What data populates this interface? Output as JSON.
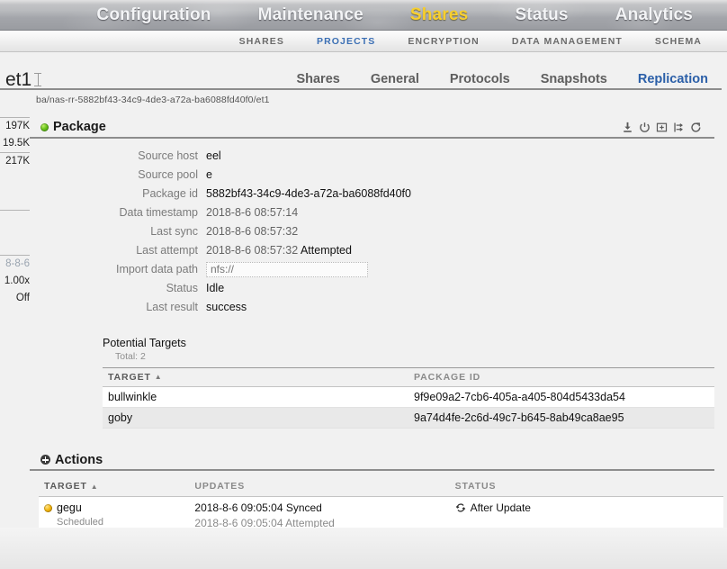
{
  "topnav": {
    "items": [
      {
        "label": "Configuration",
        "active": false
      },
      {
        "label": "Maintenance",
        "active": false
      },
      {
        "label": "Shares",
        "active": true
      },
      {
        "label": "Status",
        "active": false
      },
      {
        "label": "Analytics",
        "active": false
      }
    ],
    "active_color": "#f7cf2e"
  },
  "subnav": {
    "items": [
      {
        "label": "SHARES",
        "active": false
      },
      {
        "label": "PROJECTS",
        "active": true
      },
      {
        "label": "ENCRYPTION",
        "active": false
      },
      {
        "label": "DATA MANAGEMENT",
        "active": false
      },
      {
        "label": "SCHEMA",
        "active": false
      }
    ],
    "active_color": "#3b6fb4"
  },
  "page": {
    "title": "et1",
    "breadcrumb": "ba/nas-rr-5882bf43-34c9-4de3-a72a-ba6088fd40f0/et1",
    "tabs": [
      {
        "label": "Shares",
        "active": false
      },
      {
        "label": "General",
        "active": false
      },
      {
        "label": "Protocols",
        "active": false
      },
      {
        "label": "Snapshots",
        "active": false
      },
      {
        "label": "Replication",
        "active": true
      }
    ]
  },
  "sidebar": {
    "values": [
      {
        "text": "197K",
        "muted": false
      },
      {
        "text": "19.5K",
        "muted": false
      },
      {
        "text": "217K",
        "muted": false
      },
      {
        "text": "8-8-6",
        "muted": true
      },
      {
        "text": "1.00x",
        "muted": false
      },
      {
        "text": "Off",
        "muted": false
      }
    ]
  },
  "package": {
    "title": "Package",
    "status_led": "green",
    "tools": [
      {
        "name": "download-icon",
        "title": "Download"
      },
      {
        "name": "power-icon",
        "title": "Disable"
      },
      {
        "name": "clone-icon",
        "title": "Clone"
      },
      {
        "name": "sever-icon",
        "title": "Sever"
      },
      {
        "name": "update-icon",
        "title": "Update"
      }
    ],
    "fields": [
      {
        "label": "Source host",
        "value": "eel",
        "type": "text",
        "dim": false
      },
      {
        "label": "Source pool",
        "value": "e",
        "type": "text",
        "dim": false
      },
      {
        "label": "Package id",
        "value": "5882bf43-34c9-4de3-a72a-ba6088fd40f0",
        "type": "text",
        "dim": false
      },
      {
        "label": "Data timestamp",
        "value": "2018-8-6 08:57:14",
        "type": "text",
        "dim": true
      },
      {
        "label": "Last sync",
        "value": "2018-8-6 08:57:32",
        "type": "text",
        "dim": true
      },
      {
        "label": "Last attempt",
        "value": "2018-8-6 08:57:32",
        "suffix": "Attempted",
        "type": "text-suffix",
        "dim": true
      },
      {
        "label": "Import data path",
        "value": "",
        "placeholder": "nfs://",
        "type": "input",
        "dim": false
      },
      {
        "label": "Status",
        "value": "Idle",
        "type": "text",
        "dim": false
      },
      {
        "label": "Last result",
        "value": "success",
        "type": "text",
        "dim": false
      }
    ]
  },
  "potential_targets": {
    "title": "Potential Targets",
    "total_label": "Total: 2",
    "columns": [
      "TARGET",
      "PACKAGE ID"
    ],
    "sort_column": "TARGET",
    "sort_caret": "▲",
    "rows": [
      {
        "target": "bullwinkle",
        "package_id": "9f9e09a2-7cb6-405a-a405-804d5433da54"
      },
      {
        "target": "goby",
        "package_id": "9a74d4fe-2c6d-49c7-b645-8ab49ca8ae95"
      }
    ]
  },
  "actions": {
    "title": "Actions",
    "columns": [
      "TARGET",
      "UPDATES",
      "STATUS"
    ],
    "sort_column": "TARGET",
    "sort_caret": "▲",
    "rows": [
      {
        "led": "amber",
        "target": "gegu",
        "target_sub": "Scheduled",
        "update_line1": "2018-8-6 09:05:04 Synced",
        "update_line2": "2018-8-6 09:05:04 Attempted",
        "status": "After Update",
        "status_icon": "update-icon"
      }
    ]
  }
}
